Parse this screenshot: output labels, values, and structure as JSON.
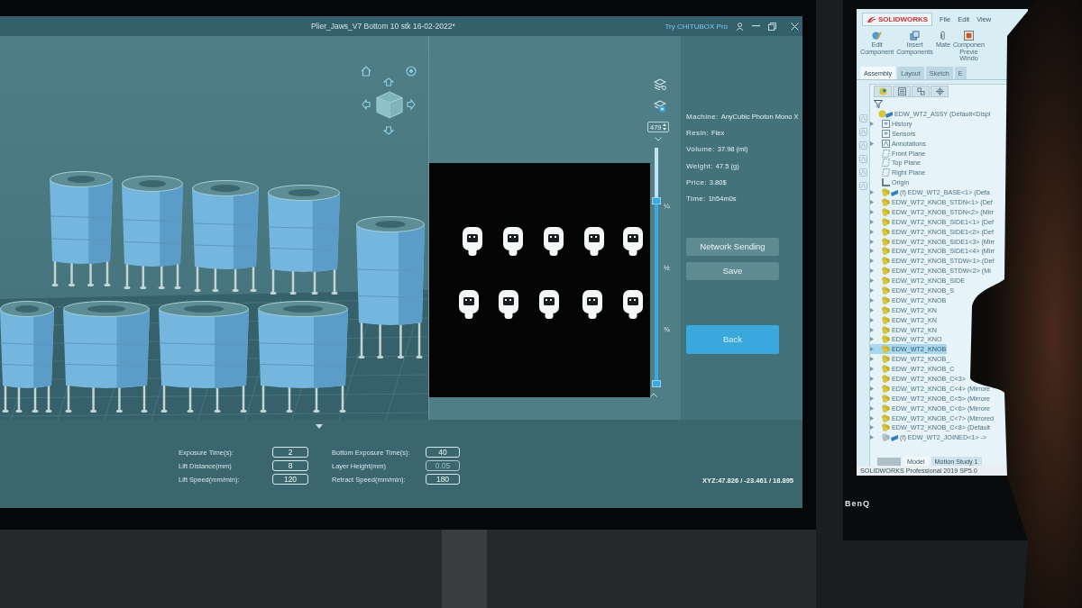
{
  "slicer": {
    "title": "Plier_Jaws_V7 Bottom 10 stk 16-02-2022*",
    "pro_link": "Try CHITUBOX Pro",
    "layer_slider": {
      "value": "479",
      "level": 0.78,
      "ticks": [
        "¼",
        "½",
        "¾"
      ]
    },
    "details": [
      {
        "label": "Machine:",
        "value": "AnyCubic Photon Mono X"
      },
      {
        "label": "Resin:",
        "value": "Flex"
      },
      {
        "label": "Volume:",
        "value": "37.98 (ml)"
      },
      {
        "label": "Weight:",
        "value": "47.5 (g)"
      },
      {
        "label": "Price:",
        "value": "3.80$"
      },
      {
        "label": "Time:",
        "value": "1h54m0s"
      }
    ],
    "actions": [
      {
        "label": "Network Sending",
        "kind": "secondary"
      },
      {
        "label": "Save",
        "kind": "secondary"
      },
      {
        "label": "Back",
        "kind": "primary"
      }
    ],
    "parameters": {
      "left": [
        {
          "label": "Exposure Time(s):",
          "value": "2",
          "disabled": false
        },
        {
          "label": "Lift Distance(mm)",
          "value": "8",
          "disabled": false
        },
        {
          "label": "Lift Speed(mm/min):",
          "value": "120",
          "disabled": false
        }
      ],
      "right": [
        {
          "label": "Bottom Exposure Time(s):",
          "value": "40",
          "disabled": false
        },
        {
          "label": "Layer Height(mm)",
          "value": "0.05",
          "disabled": true
        },
        {
          "label": "Retract Speed(mm/min):",
          "value": "180",
          "disabled": false
        }
      ]
    },
    "coordinates": "XYZ:47.826 / -23.461 / 18.895"
  },
  "cad": {
    "brand": "BenQ",
    "logo": "SOLIDWORKS",
    "menu": [
      "File",
      "Edit",
      "View"
    ],
    "toolbar": [
      {
        "lines": [
          "Edit",
          "Component"
        ]
      },
      {
        "lines": [
          "Insert",
          "Components"
        ]
      },
      {
        "lines": [
          "Mate"
        ]
      },
      {
        "lines": [
          "Componen",
          "Previe",
          "Windo"
        ]
      }
    ],
    "tabs": [
      {
        "label": "Assembly",
        "selected": true
      },
      {
        "label": "Layout",
        "selected": false
      },
      {
        "label": "Sketch",
        "selected": false
      },
      {
        "label": "E",
        "selected": false
      }
    ],
    "tree": {
      "label": "EDW_WT2_ASSY (Default<Displ",
      "kind": "assembly",
      "expandable": false,
      "selected": false,
      "children": [
        {
          "label": "History",
          "kind": "folder",
          "expandable": true,
          "selected": false
        },
        {
          "label": "Sensors",
          "kind": "folder",
          "expandable": false,
          "selected": false
        },
        {
          "label": "Annotations",
          "kind": "annotation",
          "expandable": true,
          "selected": false
        },
        {
          "label": "Front Plane",
          "kind": "plane",
          "expandable": false,
          "selected": false
        },
        {
          "label": "Top Plane",
          "kind": "plane",
          "expandable": false,
          "selected": false
        },
        {
          "label": "Right Plane",
          "kind": "plane",
          "expandable": false,
          "selected": false
        },
        {
          "label": "Origin",
          "kind": "origin",
          "expandable": false,
          "selected": false
        },
        {
          "label": "(f) EDW_WT2_BASE<1> (Defa",
          "kind": "fixed-part",
          "expandable": true,
          "selected": false
        },
        {
          "label": "EDW_WT2_KNOB_STDN<1> (Def",
          "kind": "part",
          "expandable": true,
          "selected": false
        },
        {
          "label": "EDW_WT2_KNOB_STDN<2> (Mirr",
          "kind": "part",
          "expandable": true,
          "selected": false
        },
        {
          "label": "EDW_WT2_KNOB_SIDE1<1> (Def",
          "kind": "part",
          "expandable": true,
          "selected": false
        },
        {
          "label": "EDW_WT2_KNOB_SIDE1<2> (Def",
          "kind": "part",
          "expandable": true,
          "selected": false
        },
        {
          "label": "EDW_WT2_KNOB_SIDE1<3> (Mirr",
          "kind": "part",
          "expandable": true,
          "selected": false
        },
        {
          "label": "EDW_WT2_KNOB_SIDE1<4> (Mirr",
          "kind": "part",
          "expandable": true,
          "selected": false
        },
        {
          "label": "EDW_WT2_KNOB_STDW<1> (Def",
          "kind": "part",
          "expandable": true,
          "selected": false
        },
        {
          "label": "EDW_WT2_KNOB_STDW<2> (Mi",
          "kind": "part",
          "expandable": true,
          "selected": false
        },
        {
          "label": "EDW_WT2_KNOB_SIDE",
          "kind": "part",
          "expandable": true,
          "selected": false
        },
        {
          "label": "EDW_WT2_KNOB_S",
          "kind": "part",
          "expandable": true,
          "selected": false
        },
        {
          "label": "EDW_WT2_KNOB",
          "kind": "part",
          "expandable": true,
          "selected": false
        },
        {
          "label": "EDW_WT2_KN",
          "kind": "part",
          "expandable": true,
          "selected": false
        },
        {
          "label": "EDW_WT2_KN",
          "kind": "part",
          "expandable": true,
          "selected": false
        },
        {
          "label": "EDW_WT2_KN",
          "kind": "part",
          "expandable": true,
          "selected": false
        },
        {
          "label": "EDW_WT2_KNO",
          "kind": "part",
          "expandable": true,
          "selected": false
        },
        {
          "label": "EDW_WT2_KNOB",
          "kind": "part",
          "expandable": true,
          "selected": true
        },
        {
          "label": "EDW_WT2_KNOB_",
          "kind": "part",
          "expandable": true,
          "selected": false
        },
        {
          "label": "EDW_WT2_KNOB_C",
          "kind": "part",
          "expandable": true,
          "selected": false
        },
        {
          "label": "EDW_WT2_KNOB_C<3>",
          "kind": "part",
          "expandable": true,
          "selected": false
        },
        {
          "label": "EDW_WT2_KNOB_C<4> (Mirrore",
          "kind": "part",
          "expandable": true,
          "selected": false
        },
        {
          "label": "EDW_WT2_KNOB_C<5> (Mirrore",
          "kind": "part",
          "expandable": true,
          "selected": false
        },
        {
          "label": "EDW_WT2_KNOB_C<6> (Mirrore",
          "kind": "part",
          "expandable": true,
          "selected": false
        },
        {
          "label": "EDW_WT2_KNOB_C<7> (Mirrored",
          "kind": "part",
          "expandable": true,
          "selected": false
        },
        {
          "label": "EDW_WT2_KNOB_C<8> (Default",
          "kind": "part",
          "expandable": true,
          "selected": false
        },
        {
          "label": "(f) EDW_WT2_JOINED<1> ->",
          "kind": "joined",
          "expandable": true,
          "selected": false
        }
      ]
    },
    "bottom_tabs": [
      {
        "label": "Model",
        "selected": true
      },
      {
        "label": "Motion Study 1",
        "selected": false
      }
    ],
    "status_bar": "SOLIDWORKS Professional 2019 SP5.0"
  }
}
